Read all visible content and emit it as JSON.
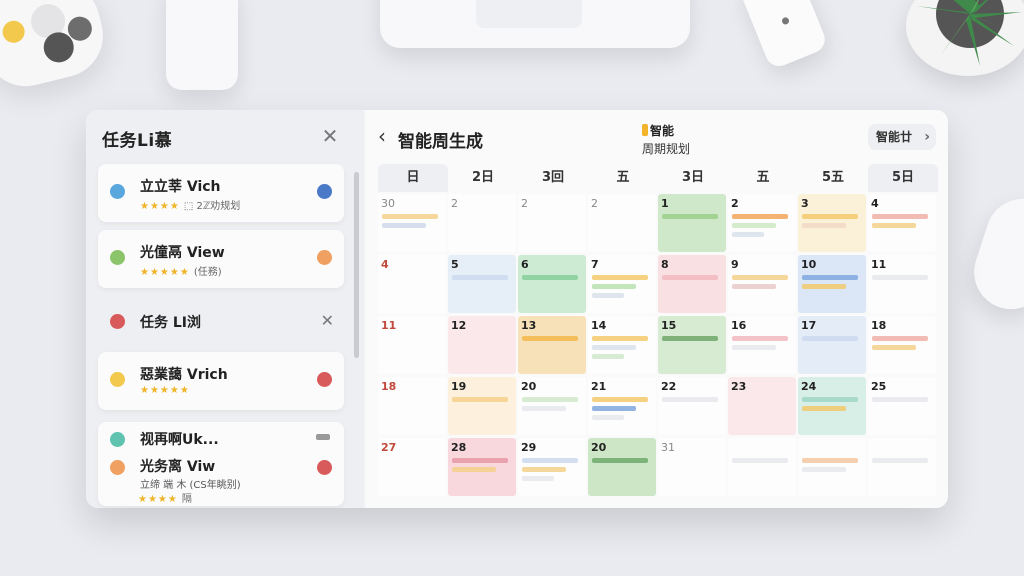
{
  "sidebar": {
    "title": "任务Li慕",
    "close_icon": "close-icon",
    "tasks": [
      {
        "title": "立立莘 Vich",
        "stars": "★★★★",
        "tag": "⬚ 2ℤ劝规划",
        "left_color": "#5aa7dd",
        "right_color": "#4a79c8"
      },
      {
        "title": "光僮鬲 View",
        "stars": "★★★★★",
        "tag": "(任務)",
        "left_color": "#8cc46a",
        "right_color": "#f0a060"
      },
      {
        "title": "惡業藹 Vrich",
        "stars": "★★★★★",
        "tag": "",
        "left_color": "#f2c94c",
        "right_color": "#d85a5a"
      }
    ],
    "group": {
      "title": "任务 LI浏",
      "dot_color": "#d85a5a"
    },
    "last_card": {
      "title1": "视再啊Uk...",
      "title2": "光务离 Viw",
      "sub": "立缔 端 木 (CS年眺别)",
      "stars": "★★★★",
      "tag": "隔",
      "dot1_color": "#5fc3b0",
      "dot2_color": "#f0a060",
      "right_color": "#d85a5a"
    }
  },
  "calendar": {
    "back_icon": "chevron-left-icon",
    "title": "智能周生成",
    "brand_line1": "智能",
    "brand_line2": "周期规划",
    "smart_button": "智能廿",
    "weekdays": [
      "日",
      "2日",
      "3回",
      "五",
      "3日",
      "五",
      "5五",
      "5日"
    ],
    "weeks": [
      [
        {
          "n": "30",
          "style": "grey",
          "bars": [
            "#f5d08a",
            "#cfd8ea"
          ]
        },
        {
          "n": "2",
          "style": "grey",
          "bars": []
        },
        {
          "n": "2",
          "style": "grey",
          "bars": []
        },
        {
          "n": "2",
          "style": "grey",
          "bars": []
        },
        {
          "n": "1",
          "style": "",
          "pic": "#cfe8c9",
          "bars": [
            "#9bcf8a"
          ]
        },
        {
          "n": "2",
          "style": "",
          "bars": [
            "#f2a65a",
            "#cde7c3",
            "#d9e0ea"
          ]
        },
        {
          "n": "3",
          "style": "",
          "pic": "#fbf1d8",
          "bars": [
            "#f3c96b",
            "#f2d9c5"
          ]
        },
        {
          "n": "4",
          "style": "",
          "bars": [
            "#f0b0a8",
            "#f5d08a"
          ]
        }
      ],
      [
        {
          "n": "4",
          "style": "red",
          "bars": []
        },
        {
          "n": "5",
          "style": "",
          "pic": "#e6eef8",
          "bars": [
            "#cbd9ee"
          ]
        },
        {
          "n": "6",
          "style": "",
          "pic": "#cdebd3",
          "bars": [
            "#86cf9a"
          ]
        },
        {
          "n": "7",
          "style": "",
          "bars": [
            "#f3c96b",
            "#b7e0b0",
            "#d9e0ea"
          ]
        },
        {
          "n": "8",
          "style": "",
          "pic": "#f8e0e3",
          "bars": [
            "#f2b8bf"
          ]
        },
        {
          "n": "9",
          "style": "",
          "bars": [
            "#f5d08a",
            "#e9c9c9"
          ]
        },
        {
          "n": "10",
          "style": "",
          "pic": "#dbe7f7",
          "bars": [
            "#7fa7de",
            "#f3c96b"
          ]
        },
        {
          "n": "11",
          "style": "",
          "bars": [
            "#e6e8ec"
          ]
        }
      ],
      [
        {
          "n": "11",
          "style": "red",
          "bars": []
        },
        {
          "n": "12",
          "style": "",
          "pic": "#fbe8ea",
          "bars": []
        },
        {
          "n": "13",
          "style": "",
          "pic": "#f7e1b8",
          "bars": [
            "#f3b94a"
          ]
        },
        {
          "n": "14",
          "style": "",
          "bars": [
            "#f3c96b",
            "#d9e0ea",
            "#cfe8c9"
          ]
        },
        {
          "n": "15",
          "style": "",
          "pic": "#d7ebd2",
          "bars": [
            "#6ea86a"
          ]
        },
        {
          "n": "16",
          "style": "",
          "bars": [
            "#f2b8bf",
            "#e6e8ec"
          ]
        },
        {
          "n": "17",
          "style": "",
          "pic": "#e4ecf8",
          "bars": [
            "#cbd9ee"
          ]
        },
        {
          "n": "18",
          "style": "",
          "bars": [
            "#f0b0a8",
            "#f5d08a"
          ]
        }
      ],
      [
        {
          "n": "18",
          "style": "red",
          "bars": []
        },
        {
          "n": "19",
          "style": "",
          "pic": "#fdf0dc",
          "bars": [
            "#f5d08a"
          ]
        },
        {
          "n": "20",
          "style": "",
          "bars": [
            "#cfe8c9",
            "#e6e8ec"
          ]
        },
        {
          "n": "21",
          "style": "",
          "bars": [
            "#f3c96b",
            "#7fa7de",
            "#e6e8ec"
          ]
        },
        {
          "n": "22",
          "style": "",
          "bars": [
            "#e6e8ec"
          ]
        },
        {
          "n": "23",
          "style": "",
          "pic": "#fbe8ea",
          "bars": []
        },
        {
          "n": "24",
          "style": "",
          "pic": "#d8efe8",
          "bars": [
            "#9fd6c4",
            "#f3c96b"
          ]
        },
        {
          "n": "25",
          "style": "",
          "bars": [
            "#e6e8ec"
          ]
        }
      ],
      [
        {
          "n": "27",
          "style": "red",
          "bars": []
        },
        {
          "n": "28",
          "style": "",
          "pic": "#f8d8dd",
          "bars": [
            "#e89aa6",
            "#f5d08a"
          ]
        },
        {
          "n": "29",
          "style": "",
          "bars": [
            "#cbd9ee",
            "#f5d08a",
            "#e6e8ec"
          ]
        },
        {
          "n": "20",
          "style": "",
          "pic": "#cde7c6",
          "bars": [
            "#6ea86a"
          ]
        },
        {
          "n": "31",
          "style": "grey",
          "bars": []
        },
        {
          "n": "",
          "style": "",
          "bars": [
            "#e6e8ec"
          ]
        },
        {
          "n": "",
          "style": "",
          "bars": [
            "#f2c8a0",
            "#e6e8ec"
          ]
        },
        {
          "n": "",
          "style": "",
          "bars": [
            "#e6e8ec"
          ]
        }
      ]
    ]
  }
}
